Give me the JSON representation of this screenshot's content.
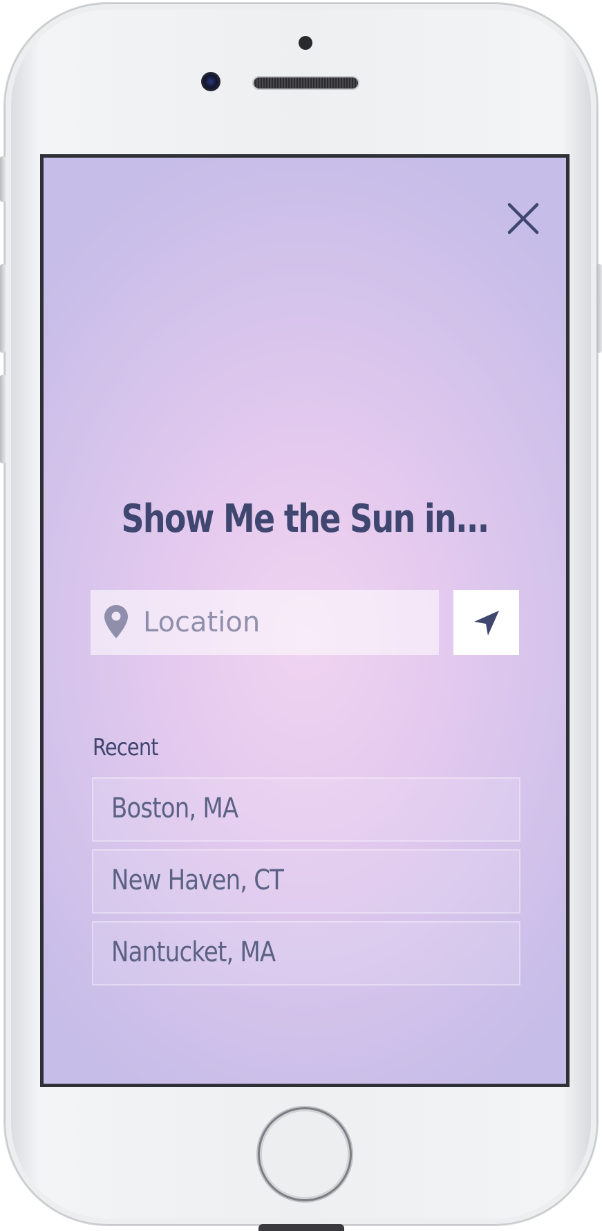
{
  "screen": {
    "title": "Show Me the Sun in...",
    "close_icon": "close-icon",
    "search": {
      "placeholder": "Location",
      "value": "",
      "pin_icon": "map-pin-icon",
      "locate_icon": "navigation-arrow-icon"
    },
    "recent": {
      "label": "Recent",
      "items": [
        {
          "label": "Boston, MA"
        },
        {
          "label": "New Haven, CT"
        },
        {
          "label": "Nantucket, MA"
        }
      ]
    }
  },
  "colors": {
    "primary_text": "#3f4670",
    "secondary_text": "#5c6285",
    "placeholder_text": "#8f8fab",
    "background_center": "#f0d4f1",
    "background_edge": "#c6bde8"
  }
}
